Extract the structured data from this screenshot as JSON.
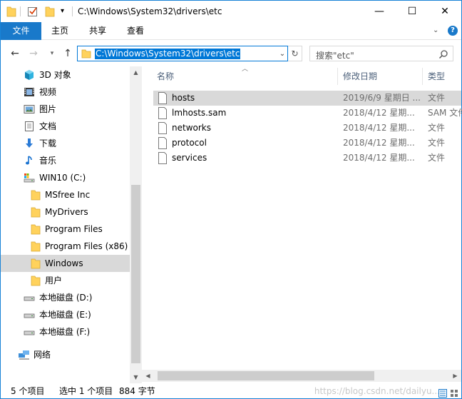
{
  "window": {
    "title": "C:\\Windows\\System32\\drivers\\etc",
    "controls": {
      "minimize": "—",
      "maximize": "☐",
      "close": "✕"
    }
  },
  "ribbon": {
    "tabs": [
      {
        "label": "文件",
        "active": true
      },
      {
        "label": "主页"
      },
      {
        "label": "共享"
      },
      {
        "label": "查看"
      }
    ],
    "expand_icon": "chevron-down-icon",
    "help_icon": "help-icon"
  },
  "address": {
    "path": "C:\\Windows\\System32\\drivers\\etc",
    "search_placeholder": "搜索\"etc\""
  },
  "sidebar": {
    "items": [
      {
        "label": "3D 对象",
        "icon": "3d-objects-icon"
      },
      {
        "label": "视频",
        "icon": "video-icon"
      },
      {
        "label": "图片",
        "icon": "pictures-icon"
      },
      {
        "label": "文档",
        "icon": "documents-icon"
      },
      {
        "label": "下载",
        "icon": "download-icon"
      },
      {
        "label": "音乐",
        "icon": "music-icon"
      },
      {
        "label": "WIN10 (C:)",
        "icon": "drive-c-icon"
      },
      {
        "label": "MSfree Inc",
        "icon": "folder-icon"
      },
      {
        "label": "MyDrivers",
        "icon": "folder-icon"
      },
      {
        "label": "Program Files",
        "icon": "folder-icon"
      },
      {
        "label": "Program Files (x86)",
        "icon": "folder-icon"
      },
      {
        "label": "Windows",
        "icon": "folder-icon",
        "selected": true
      },
      {
        "label": "用户",
        "icon": "folder-icon"
      },
      {
        "label": "本地磁盘 (D:)",
        "icon": "drive-icon"
      },
      {
        "label": "本地磁盘 (E:)",
        "icon": "drive-icon"
      },
      {
        "label": "本地磁盘 (F:)",
        "icon": "drive-icon"
      },
      {
        "label": "网络",
        "icon": "network-icon"
      }
    ]
  },
  "columns": {
    "name": "名称",
    "date": "修改日期",
    "type": "类型"
  },
  "files": [
    {
      "name": "hosts",
      "date": "2019/6/9 星期日 ...",
      "type": "文件",
      "selected": true
    },
    {
      "name": "lmhosts.sam",
      "date": "2018/4/12 星期...",
      "type": "SAM 文件"
    },
    {
      "name": "networks",
      "date": "2018/4/12 星期...",
      "type": "文件"
    },
    {
      "name": "protocol",
      "date": "2018/4/12 星期...",
      "type": "文件"
    },
    {
      "name": "services",
      "date": "2018/4/12 星期...",
      "type": "文件"
    }
  ],
  "status": {
    "count": "5 个项目",
    "selection": "选中 1 个项目",
    "size": "884 字节",
    "watermark": "https://blog.csdn.net/dailyu..."
  },
  "colors": {
    "accent": "#1979ca",
    "selection": "#d9d9d9",
    "address_highlight": "#0078d7",
    "folder": "#ffd25c"
  }
}
